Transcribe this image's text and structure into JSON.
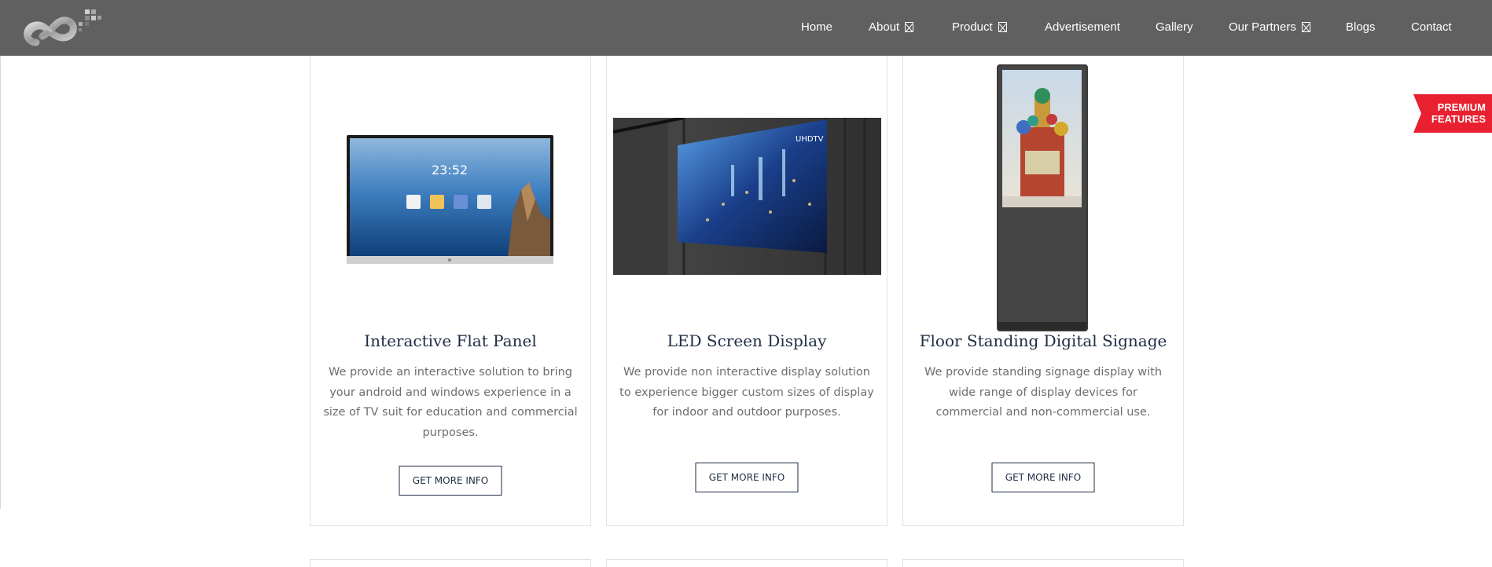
{
  "header": {
    "logo": "infinity-logo",
    "nav": [
      {
        "label": "Home",
        "dropdown": false
      },
      {
        "label": "About",
        "dropdown": true
      },
      {
        "label": "Product",
        "dropdown": true
      },
      {
        "label": "Advertisement",
        "dropdown": false
      },
      {
        "label": "Gallery",
        "dropdown": false
      },
      {
        "label": "Our Partners",
        "dropdown": true
      },
      {
        "label": "Blogs",
        "dropdown": false
      },
      {
        "label": "Contact",
        "dropdown": false
      }
    ]
  },
  "products": [
    {
      "title": "Interactive Flat Panel",
      "description": "We provide an interactive solution to bring your android and windows experience in a size of TV suit for education and commercial purposes.",
      "button": "GET MORE INFO",
      "image": "interactive-flat-panel-image",
      "screen_time": "23:52"
    },
    {
      "title": "LED Screen Display",
      "description": "We provide non interactive display solution to experience bigger custom sizes of display for indoor and outdoor purposes.",
      "button": "GET MORE INFO",
      "image": "led-video-wall-image",
      "screen_brand": "UHDTV"
    },
    {
      "title": "Floor Standing Digital Signage",
      "description": "We provide standing signage display with wide range of display devices for commercial and non-commercial use.",
      "button": "GET MORE INFO",
      "image": "floor-standing-kiosk-image"
    }
  ],
  "premium_ribbon": {
    "line1": "PREMIUM",
    "line2": "FEATURES"
  },
  "colors": {
    "header_bg": "#606060",
    "title": "#1d2c44",
    "desc": "#6e6e6e",
    "ribbon": "#e8202f"
  }
}
